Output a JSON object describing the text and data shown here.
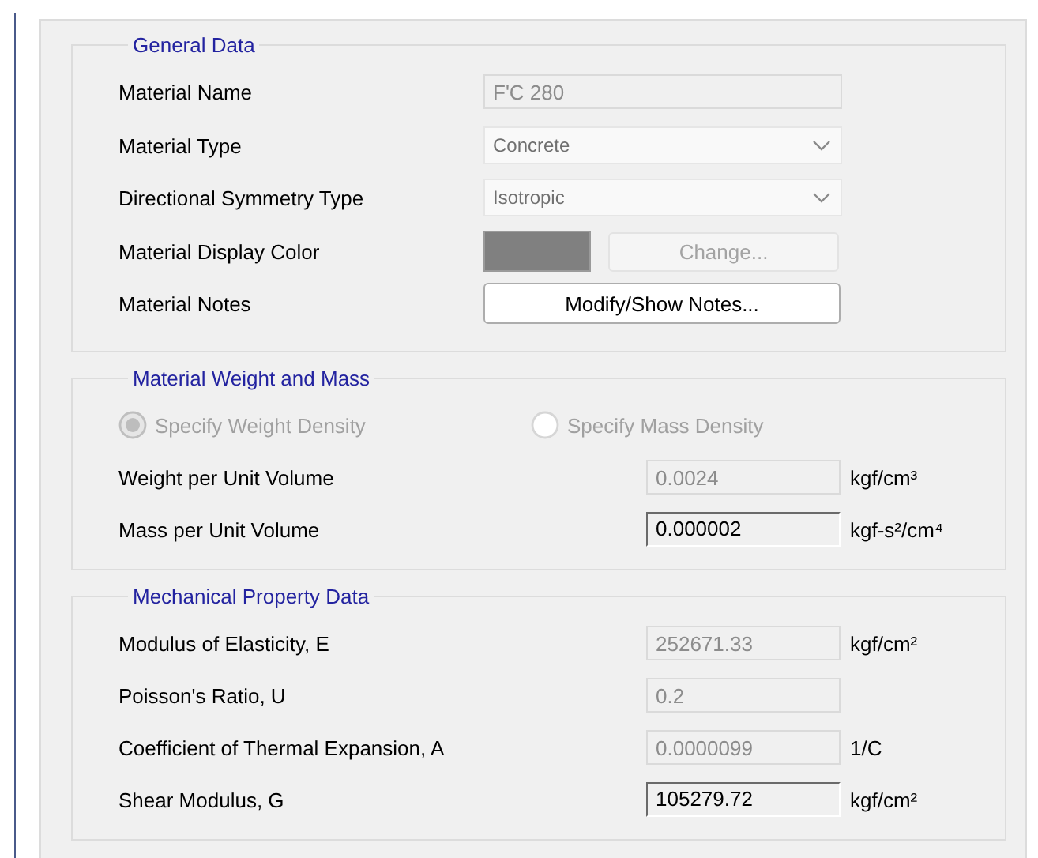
{
  "general_data": {
    "title": "General Data",
    "rows": [
      {
        "kind": "text",
        "label": "Material Name",
        "value": "F'C 280",
        "disabled": true
      },
      {
        "kind": "dropdown",
        "label": "Material Type",
        "value": "Concrete",
        "disabled": true
      },
      {
        "kind": "dropdown",
        "label": "Directional Symmetry Type",
        "value": "Isotropic",
        "disabled": true
      },
      {
        "kind": "color",
        "label": "Material Display Color",
        "color": "#808080",
        "button": {
          "label": "Change...",
          "disabled": true
        }
      },
      {
        "kind": "button",
        "label": "Material Notes",
        "button": {
          "label": "Modify/Show Notes...",
          "disabled": false
        }
      }
    ]
  },
  "weight_and_mass": {
    "title": "Material Weight and Mass",
    "radios": [
      {
        "label": "Specify Weight Density",
        "selected": true,
        "disabled": true
      },
      {
        "label": "Specify Mass Density",
        "selected": false,
        "disabled": true
      }
    ],
    "rows": [
      {
        "label": "Weight per Unit Volume",
        "value": "0.0024",
        "unit": "kgf/cm³",
        "disabled": true
      },
      {
        "label": "Mass per Unit Volume",
        "value": "0.000002",
        "unit": "kgf-s²/cm⁴",
        "disabled": false
      }
    ]
  },
  "mechanical_property_data": {
    "title": "Mechanical Property Data",
    "rows": [
      {
        "label": "Modulus of Elasticity,  E",
        "value": "252671.33",
        "unit": "kgf/cm²",
        "disabled": true
      },
      {
        "label": "Poisson's Ratio,  U",
        "value": "0.2",
        "disabled": true
      },
      {
        "label": "Coefficient of Thermal Expansion,  A",
        "value": "0.0000099",
        "unit": "1/C",
        "disabled": true
      },
      {
        "label": "Shear Modulus,  G",
        "value": "105279.72",
        "unit": "kgf/cm²",
        "disabled": false
      }
    ]
  }
}
